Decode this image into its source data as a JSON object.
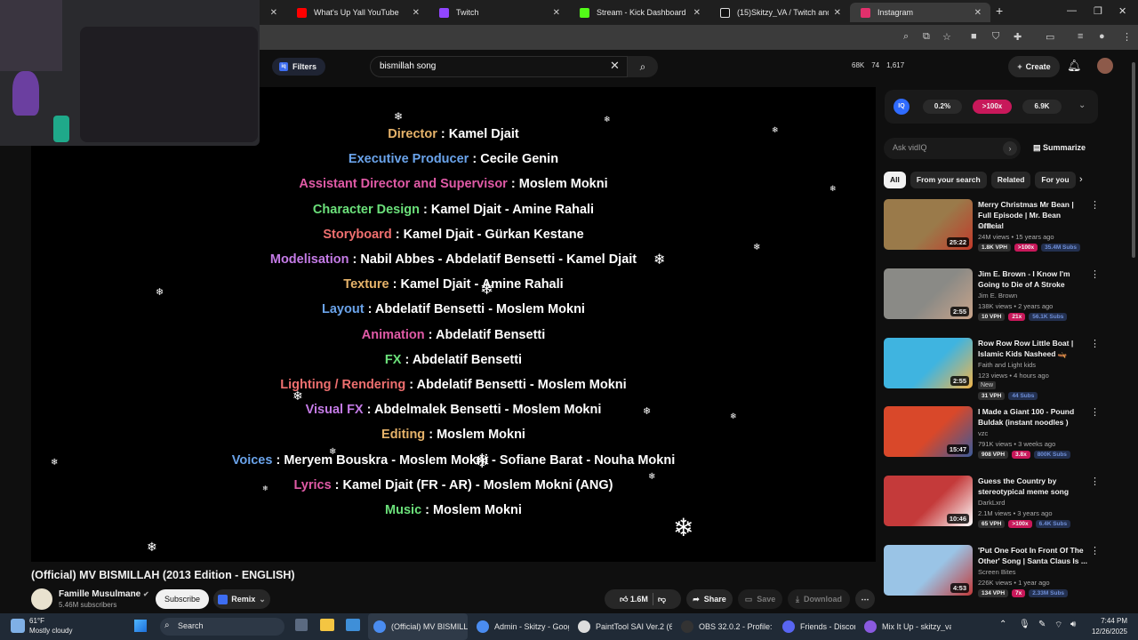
{
  "browser": {
    "tabs": [
      {
        "label": "",
        "icon": "tab-icon",
        "color": "#555555",
        "closable": true
      },
      {
        "label": "What's Up Yall YouTube",
        "icon": "youtube-icon",
        "color": "#ff0000"
      },
      {
        "label": "Twitch",
        "icon": "twitch-icon",
        "color": "#9146ff"
      },
      {
        "label": "Stream - Kick Dashboard",
        "icon": "kick-icon",
        "color": "#53fc18"
      },
      {
        "label": "(15)Skitzy_VA / Twitch and You",
        "icon": "tiktok-icon",
        "color": "#111111"
      },
      {
        "label": "Instagram",
        "icon": "instagram-icon",
        "color": "#e1306c"
      }
    ]
  },
  "header": {
    "filters_label": "Filters",
    "search_value": "bismillah song",
    "stats": [
      "68K",
      "74",
      "1,617"
    ],
    "create_label": "Create"
  },
  "video": {
    "credits": [
      {
        "role": "Director",
        "names": "Kamel Djait",
        "color": "#e6b36a"
      },
      {
        "role": "Executive Producer",
        "names": "Cecile Genin",
        "color": "#6aa3ea"
      },
      {
        "role": "Assistant Director and Supervisor",
        "names": "Moslem Mokni",
        "color": "#e05aa6"
      },
      {
        "role": "Character Design",
        "names": "Kamel Djait - Amine Rahali",
        "color": "#6be07a"
      },
      {
        "role": "Storyboard",
        "names": "Kamel Djait - Gürkan Kestane",
        "color": "#ee6f6f"
      },
      {
        "role": "Modelisation",
        "names": "Nabil Abbes - Abdelatif Bensetti - Kamel Djait",
        "color": "#c47be6"
      },
      {
        "role": "Texture",
        "names": "Kamel Djait - Amine Rahali",
        "color": "#e6b36a"
      },
      {
        "role": "Layout",
        "names": "Abdelatif Bensetti - Moslem Mokni",
        "color": "#6aa3ea"
      },
      {
        "role": "Animation",
        "names": "Abdelatif Bensetti",
        "color": "#e05aa6"
      },
      {
        "role": "FX",
        "names": "Abdelatif Bensetti",
        "color": "#6be07a"
      },
      {
        "role": "Lighting / Rendering",
        "names": "Abdelatif Bensetti - Moslem Mokni",
        "color": "#ee6f6f"
      },
      {
        "role": "Visual FX",
        "names": "Abdelmalek Bensetti - Moslem Mokni",
        "color": "#c47be6"
      },
      {
        "role": "Editing",
        "names": "Moslem Mokni",
        "color": "#e6b36a"
      },
      {
        "role": "Voices",
        "names": "Meryem Bouskra - Moslem Mokni - Sofiane Barat - Nouha Mokni",
        "color": "#6aa3ea"
      },
      {
        "role": "Lyrics",
        "names": "Kamel Djait (FR - AR) - Moslem Mokni (ANG)",
        "color": "#e05aa6"
      },
      {
        "role": "Music",
        "names": "Moslem Mokni",
        "color": "#6be07a"
      }
    ],
    "title": "(Official) MV BISMILLAH (2013 Edition - ENGLISH)",
    "channel": "Famille Musulmane",
    "subscribers": "5.46M subscribers",
    "subscribe_label": "Subscribe",
    "remix_label": "Remix",
    "likes": "1.6M",
    "share_label": "Share",
    "save_label": "Save",
    "download_label": "Download"
  },
  "sidebar": {
    "vidiq_logo": "IQ",
    "vidiq_stats": [
      {
        "value": "0.2%",
        "color": "#2a2a2a"
      },
      {
        "value": ">100x",
        "color": "#c8185a"
      },
      {
        "value": "6.9K",
        "color": "#2a2a2a"
      }
    ],
    "ask_placeholder": "Ask vidIQ",
    "summarize_label": "Summarize",
    "chips": [
      "All",
      "From your search",
      "Related",
      "For you"
    ],
    "recommendations": [
      {
        "title": "Merry Christmas Mr Bean | Full Episode | Mr. Bean Official",
        "channel": "Mr Bean",
        "meta": "24M views • 15 years ago",
        "duration": "25:22",
        "vph": "1.8K VPH",
        "mult": ">100x",
        "subs": "35.4M Subs",
        "new": "",
        "thumb": [
          "#9a7a4a",
          "#c23a2a"
        ]
      },
      {
        "title": "Jim E. Brown - I Know I'm Going to Die of A Stroke",
        "channel": "Jim E. Brown",
        "meta": "138K views • 2 years ago",
        "duration": "2:55",
        "vph": "10 VPH",
        "mult": "21x",
        "subs": "56.1K Subs",
        "new": "",
        "thumb": [
          "#8a8a86",
          "#c9a48a"
        ]
      },
      {
        "title": "Row Row Row Little Boat | Islamic Kids Nasheed 🛶",
        "channel": "Faith and Light kids",
        "meta": "123 views • 4 hours ago",
        "duration": "2:55",
        "vph": "31 VPH",
        "mult": "",
        "subs": "44 Subs",
        "new": "New",
        "thumb": [
          "#3fb4e0",
          "#f2b54a"
        ]
      },
      {
        "title": "I Made a Giant 100 - Pound Buldak (instant noodles )",
        "channel": "vzc",
        "meta": "791K views • 3 weeks ago",
        "duration": "15:47",
        "vph": "908 VPH",
        "mult": "3.8x",
        "subs": "800K Subs",
        "new": "",
        "thumb": [
          "#d9482a",
          "#3a5a9a"
        ]
      },
      {
        "title": "Guess the Country by stereotypical meme song",
        "channel": "DarkLxrd",
        "meta": "2.1M views • 3 years ago",
        "duration": "10:46",
        "vph": "65 VPH",
        "mult": ">100x",
        "subs": "6.4K Subs",
        "new": "",
        "thumb": [
          "#c43a3a",
          "#ffffff"
        ]
      },
      {
        "title": "'Put One Foot In Front Of The Other' Song | Santa Claus Is ...",
        "channel": "Screen Bites",
        "meta": "226K views • 1 year ago",
        "duration": "4:53",
        "vph": "134 VPH",
        "mult": "7x",
        "subs": "2.33M Subs",
        "new": "",
        "thumb": [
          "#9ac4e6",
          "#c23a3a"
        ]
      }
    ]
  },
  "taskbar": {
    "temperature": "61°F",
    "weather": "Mostly cloudy",
    "search_label": "Search",
    "apps": [
      {
        "label": "(Official) MV BISMILLA",
        "color": "#4a8cf0",
        "active": true
      },
      {
        "label": "Admin - Skitzy - Goog",
        "color": "#4a8cf0",
        "active": false
      },
      {
        "label": "PaintTool SAI Ver.2 (64",
        "color": "#dddddd",
        "active": false
      },
      {
        "label": "OBS 32.0.2 - Profile: St",
        "color": "#333333",
        "active": false
      },
      {
        "label": "Friends - Discord",
        "color": "#5865f2",
        "active": false
      },
      {
        "label": "Mix It Up - skitzy_va -",
        "color": "#8a5ae0",
        "active": false
      }
    ],
    "time": "7:44 PM",
    "date": "12/26/2025"
  }
}
